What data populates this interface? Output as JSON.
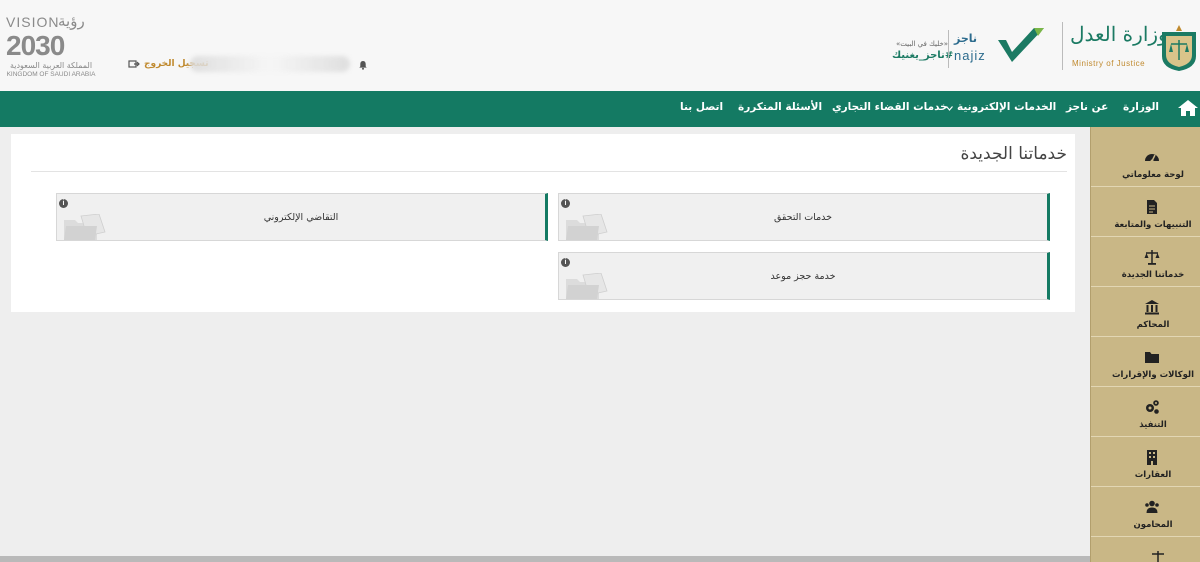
{
  "header": {
    "vision": {
      "title_en": "VISION",
      "title_ar": "رؤية",
      "year": "2030",
      "country_ar": "المملكة العربية السعودية",
      "country_en": "KINGDOM OF SAUDI ARABIA"
    },
    "logout_label": "تسجيل الخروج",
    "najiz": {
      "tagline_small": "«خليك في البيت»",
      "hashtag": "#ناجز_يغنيك",
      "name_ar": "ناجز",
      "name_en": "najiz"
    },
    "moj": {
      "name_ar": "وزارة العدل",
      "name_en": "Ministry of Justice"
    }
  },
  "nav": {
    "items": [
      {
        "label": "الوزارة"
      },
      {
        "label": "عن ناجز"
      },
      {
        "label": "الخدمات الإلكترونية"
      },
      {
        "label": "خدمات القضاء التجاري"
      },
      {
        "label": "الأسئلة المتكررة"
      },
      {
        "label": "اتصل بنا"
      }
    ]
  },
  "sidebar": {
    "items": [
      {
        "label": "لوحة معلوماتي",
        "icon": "dashboard-icon"
      },
      {
        "label": "التنبيهات والمتابعة",
        "icon": "document-icon"
      },
      {
        "label": "خدماتنا الجديدة",
        "icon": "scales-icon"
      },
      {
        "label": "المحاكم",
        "icon": "courthouse-icon"
      },
      {
        "label": "الوكالات والإقرارات",
        "icon": "folder-icon"
      },
      {
        "label": "التنفيذ",
        "icon": "gears-icon"
      },
      {
        "label": "العقارات",
        "icon": "building-icon"
      },
      {
        "label": "المحامون",
        "icon": "users-icon"
      }
    ]
  },
  "main": {
    "title": "خدماتنا الجديدة",
    "cards": [
      {
        "label": "خدمات التحقق"
      },
      {
        "label": "التقاضي الإلكتروني"
      },
      {
        "label": "خدمة حجز موعد"
      }
    ],
    "info_glyph": "i"
  },
  "colors": {
    "primary_green": "#147a63",
    "sidebar_gold": "#c9b786",
    "accent_gold": "#c08a2f"
  }
}
